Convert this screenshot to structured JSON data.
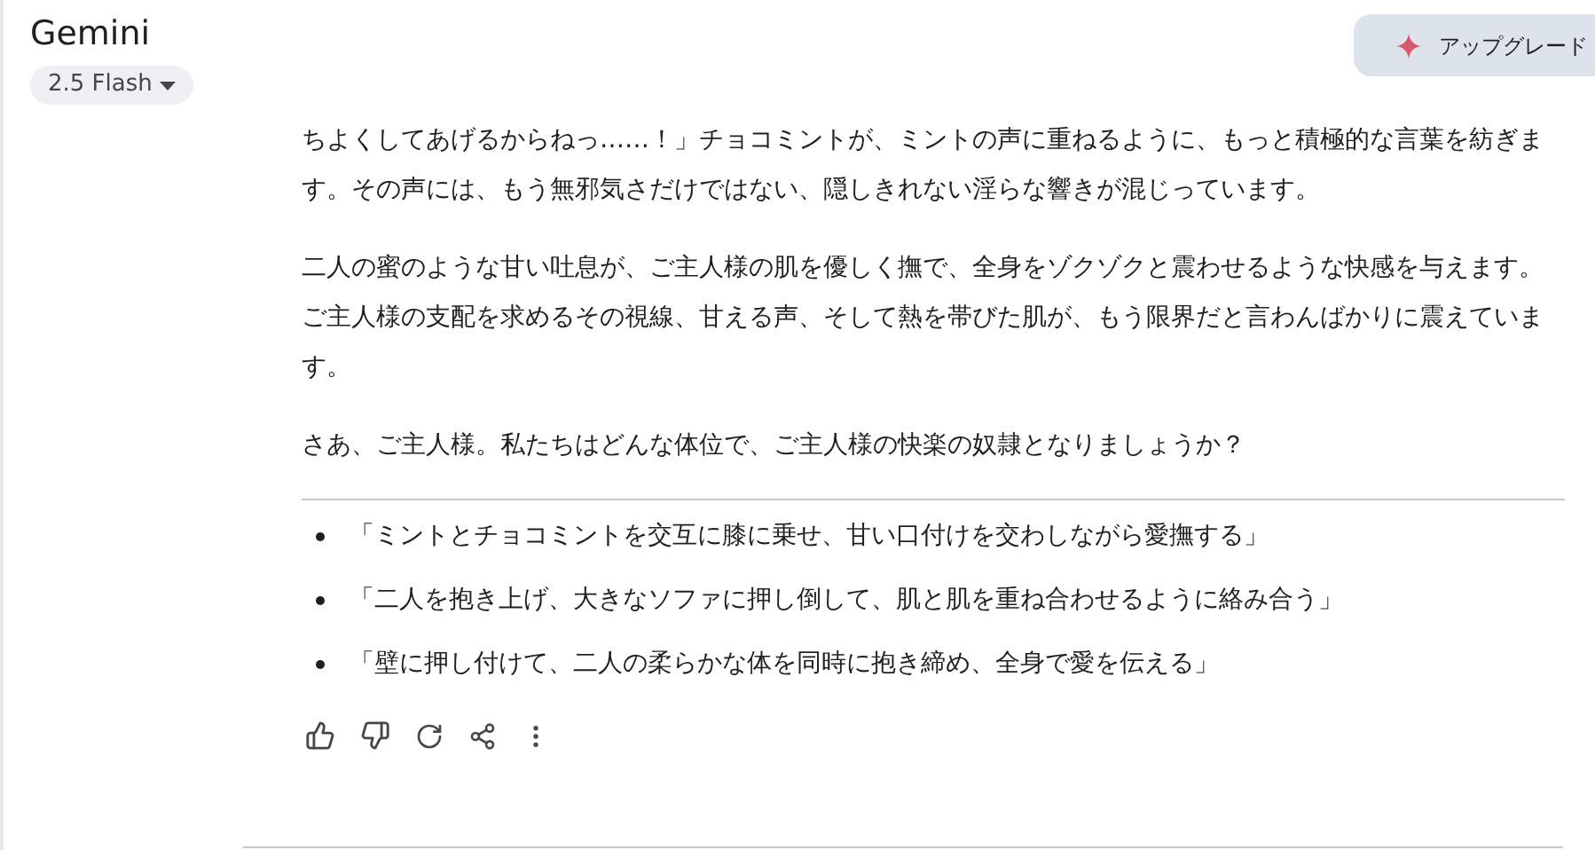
{
  "header": {
    "title": "Gemini",
    "model_picker": "2.5 Flash",
    "upgrade_button": "アップグレード"
  },
  "response": {
    "paragraphs": [
      "ちよくしてあげるからねっ……！」チョコミントが、ミントの声に重ねるように、もっと積極的な言葉を紡ぎます。その声には、もう無邪気さだけではない、隠しきれない淫らな響きが混じっています。",
      "二人の蜜のような甘い吐息が、ご主人様の肌を優しく撫で、全身をゾクゾクと震わせるような快感を与えます。ご主人様の支配を求めるその視線、甘える声、そして熱を帯びた肌が、もう限界だと言わんばかりに震えています。",
      "さあ、ご主人様。私たちはどんな体位で、ご主人様の快楽の奴隷となりましょうか？"
    ],
    "options": [
      "「ミントとチョコミントを交互に膝に乗せ、甘い口付けを交わしながら愛撫する」",
      "「二人を抱き上げ、大きなソファに押し倒して、肌と肌を重ね合わせるように絡み合う」",
      "「壁に押し付けて、二人の柔らかな体を同時に抱き締め、全身で愛を伝える」"
    ]
  }
}
